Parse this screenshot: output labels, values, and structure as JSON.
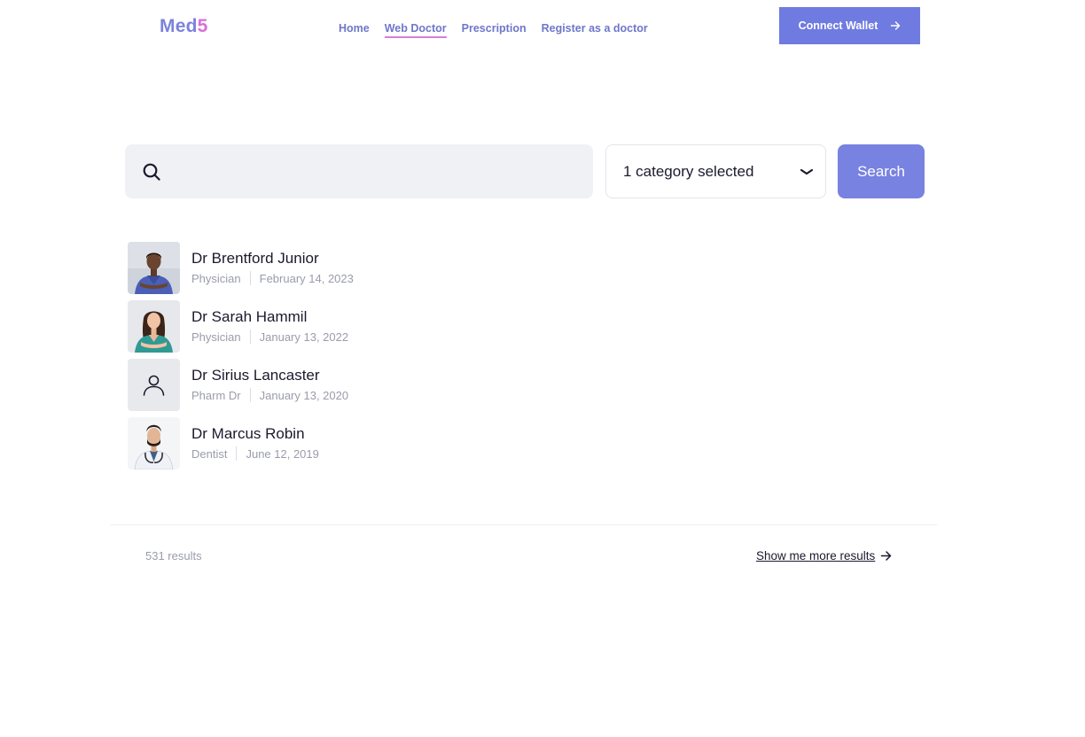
{
  "header": {
    "logo_text": "Med",
    "logo_accent": "5",
    "nav": [
      {
        "label": "Home",
        "active": false
      },
      {
        "label": "Web Doctor",
        "active": true
      },
      {
        "label": "Prescription",
        "active": false
      },
      {
        "label": "Register as a doctor",
        "active": false
      }
    ],
    "connect_label": "Connect Wallet",
    "connect_icon": "arrow-right-icon"
  },
  "search": {
    "placeholder": "",
    "value": "",
    "icon": "search-icon",
    "category_label": "1 category selected",
    "category_icon": "chevron-down-icon",
    "button_label": "Search"
  },
  "doctors": [
    {
      "name": "Dr Brentford Junior",
      "role": "Physician",
      "date": "February 14,  2023",
      "avatar": "photo",
      "scrubs": "#4a5fb5"
    },
    {
      "name": "Dr Sarah Hammil",
      "role": "Physician",
      "date": "January 13, 2022",
      "avatar": "photo",
      "scrubs": "#2f9a94"
    },
    {
      "name": "Dr Sirius Lancaster",
      "role": "Pharm Dr",
      "date": "January 13, 2020",
      "avatar": "placeholder-user-icon"
    },
    {
      "name": "Dr Marcus Robin",
      "role": "Dentist",
      "date": "June 12,  2019",
      "avatar": "photo",
      "scrubs": "#eef1f5"
    }
  ],
  "footer": {
    "results": "531 results",
    "more_label": "Show me more results",
    "more_icon": "arrow-right-icon"
  },
  "colors": {
    "brand": "#7b82dd",
    "accent": "#d96fd8",
    "button": "#6f7be0"
  }
}
